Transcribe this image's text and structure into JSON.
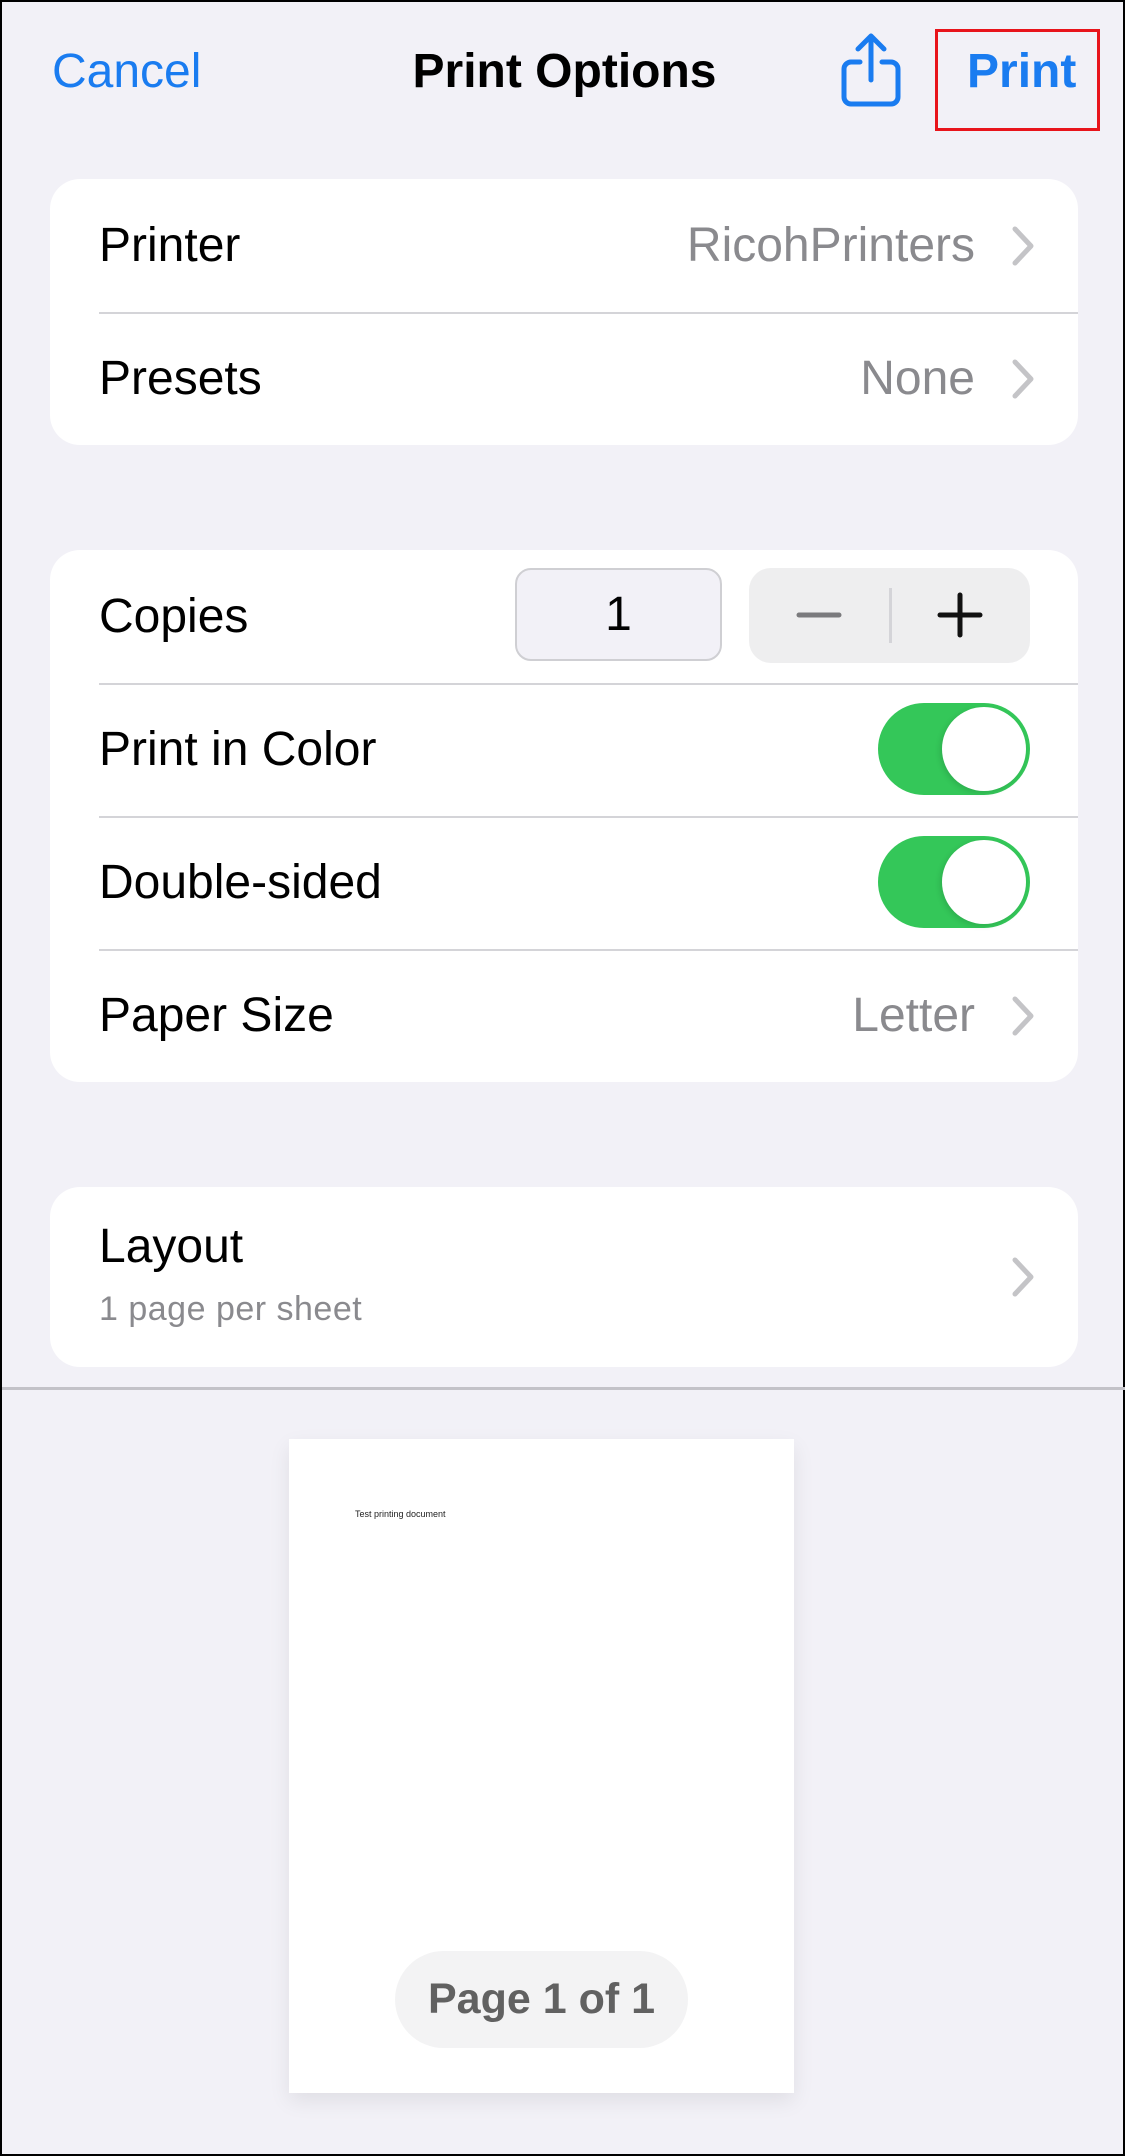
{
  "nav": {
    "cancel_label": "Cancel",
    "title": "Print Options",
    "share_icon": "share-icon",
    "print_label": "Print"
  },
  "colors": {
    "accent": "#1a7cf0",
    "toggle_on": "#34c759",
    "highlight": "#e8141b",
    "secondary_text": "#8a8a8e"
  },
  "printer_section": {
    "rows": [
      {
        "label": "Printer",
        "value": "RicohPrinters"
      },
      {
        "label": "Presets",
        "value": "None"
      }
    ]
  },
  "options_section": {
    "copies": {
      "label": "Copies",
      "value": "1",
      "decrement_icon": "minus-icon",
      "increment_icon": "plus-icon"
    },
    "print_in_color": {
      "label": "Print in Color",
      "on": true
    },
    "double_sided": {
      "label": "Double-sided",
      "on": true
    },
    "paper_size": {
      "label": "Paper Size",
      "value": "Letter"
    }
  },
  "layout_section": {
    "title": "Layout",
    "subtitle": "1 page per sheet"
  },
  "preview": {
    "document_text": "Test printing document",
    "page_indicator": "Page 1 of 1"
  }
}
